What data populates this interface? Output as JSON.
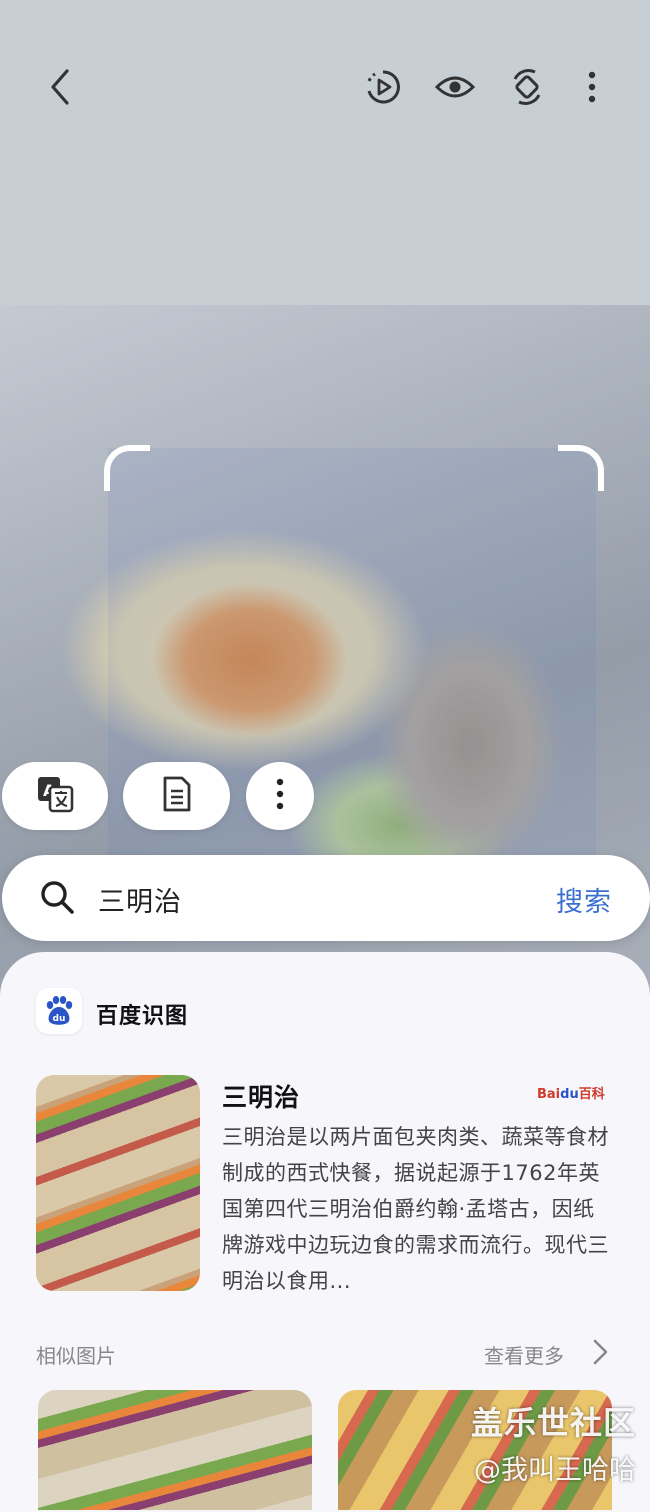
{
  "top_bar": {
    "back_icon": "back-arrow-icon",
    "actions": [
      {
        "icon": "motion-photo-icon"
      },
      {
        "icon": "eye-icon"
      },
      {
        "icon": "rotate-icon"
      },
      {
        "icon": "more-vert-icon"
      }
    ]
  },
  "quick_actions": [
    {
      "icon": "translate-icon"
    },
    {
      "icon": "document-text-icon"
    },
    {
      "icon": "more-vert-icon"
    }
  ],
  "search": {
    "query": "三明治",
    "button_label": "搜索"
  },
  "results": {
    "source_name": "百度识图",
    "item": {
      "title": "三明治",
      "provider_logo": {
        "brand": "Bai",
        "mark": "du",
        "suffix": "百科"
      },
      "description": "三明治是以两片面包夹肉类、蔬菜等食材制成的西式快餐，据说起源于1762年英国第四代三明治伯爵约翰·孟塔古，因纸牌游戏中边玩边食的需求而流行。现代三明治以食用..."
    },
    "similar_label": "相似图片",
    "see_more_label": "查看更多"
  },
  "watermark": {
    "line1": "盖乐世社区",
    "line2": "@我叫王哈哈"
  },
  "colors": {
    "accent": "#3a6fd1",
    "top_bar_bg": "#c7ced4",
    "panel_bg": "#f6f6fb"
  }
}
